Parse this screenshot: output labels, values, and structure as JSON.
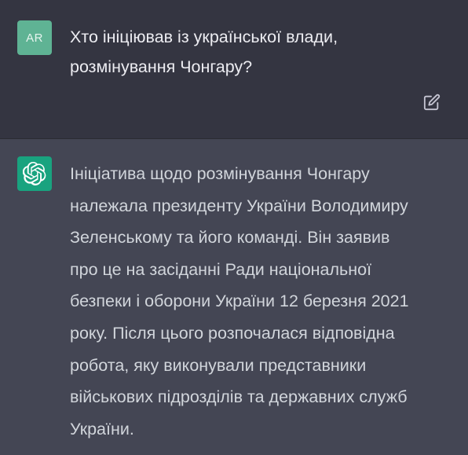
{
  "user": {
    "avatar_initials": "AR",
    "message_lines": [
      "Хто ініціював із української влади,",
      "розмінування Чонгару?"
    ],
    "edit_icon": "edit-icon"
  },
  "assistant": {
    "avatar_icon": "openai-logo-icon",
    "message_lines": [
      "Ініціатива щодо розмінування Чонгару",
      "належала президенту України Володимиру",
      "Зеленському та його команді. Він заявив",
      "про це на засіданні Ради національної",
      "безпеки і оборони України 12 березня 2021",
      "року. Після цього розпочалася відповідна",
      "робота, яку виконували представники",
      "військових підрозділів та державних служб",
      "України."
    ]
  },
  "colors": {
    "user_bg": "#343541",
    "assistant_bg": "#444654",
    "user_avatar": "#5fb394",
    "assistant_avatar": "#19a37f",
    "text": "#ececf1"
  }
}
